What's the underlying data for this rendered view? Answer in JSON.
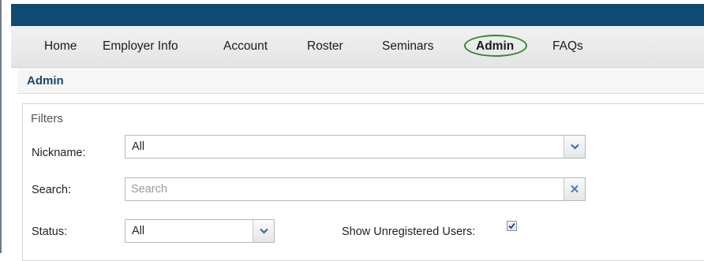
{
  "nav": {
    "items": [
      {
        "label": "Home"
      },
      {
        "label": "Employer Info"
      },
      {
        "label": "Account"
      },
      {
        "label": "Roster"
      },
      {
        "label": "Seminars"
      },
      {
        "label": "Admin"
      },
      {
        "label": "FAQs"
      }
    ],
    "active": "Admin",
    "highlight_color": "#2e8b2e"
  },
  "section": {
    "title": "Admin"
  },
  "filters": {
    "title": "Filters",
    "nickname": {
      "label": "Nickname:",
      "value": "All"
    },
    "search": {
      "label": "Search:",
      "value": "",
      "placeholder": "Search"
    },
    "status": {
      "label": "Status:",
      "value": "All"
    },
    "unregistered": {
      "label": "Show Unregistered Users:",
      "checked": true
    }
  },
  "colors": {
    "topbar": "#0e4a73",
    "section_title": "#14476e"
  }
}
